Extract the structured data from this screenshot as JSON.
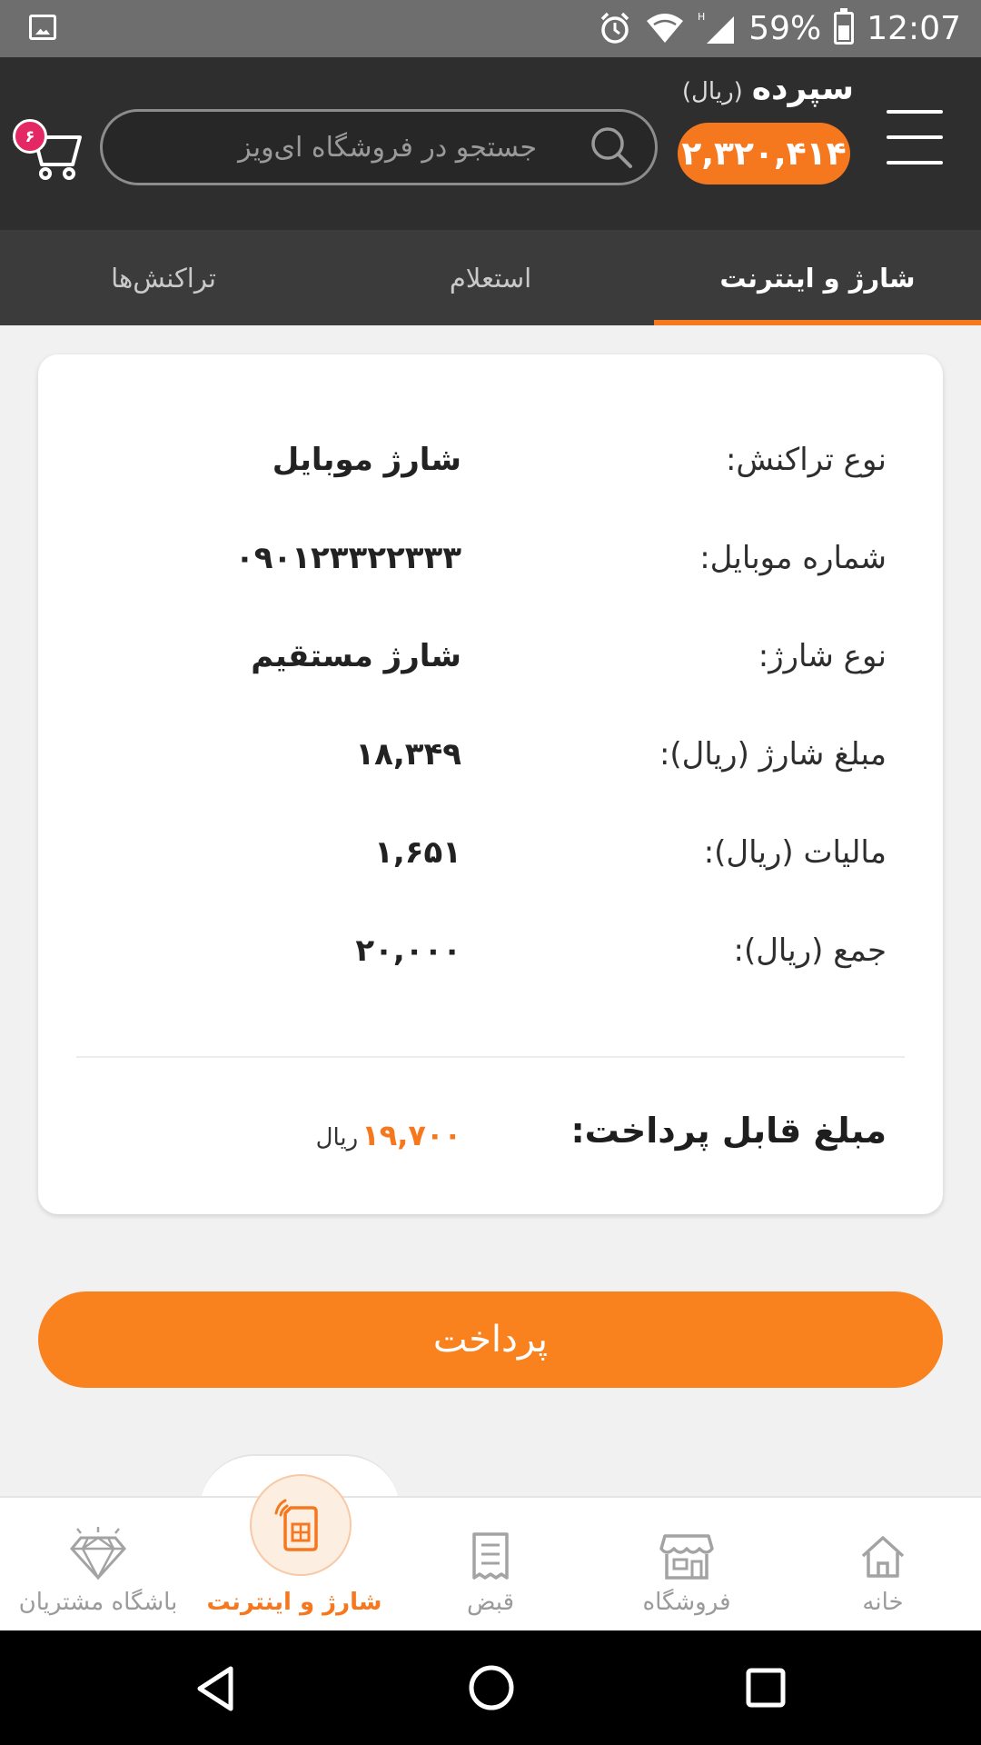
{
  "status_bar": {
    "battery": "59%",
    "time": "12:07",
    "network": "H"
  },
  "header": {
    "balance_title": "سپرده",
    "balance_unit": "(ریال)",
    "balance_value": "۲,۳۲۰,۴۱۴",
    "search_placeholder": "جستجو در فروشگاه ای‌ویز",
    "cart_count": "۶"
  },
  "tabs": [
    {
      "label": "شارژ و اینترنت",
      "active": true
    },
    {
      "label": "استعلام",
      "active": false
    },
    {
      "label": "تراکنش‌ها",
      "active": false
    }
  ],
  "summary": {
    "rows": [
      {
        "label": "نوع تراکنش:",
        "value": "شارژ موبایل"
      },
      {
        "label": "شماره موبایل:",
        "value": "۰۹۰۱۲۳۳۲۲۳۳۳"
      },
      {
        "label": "نوع شارژ:",
        "value": "شارژ مستقیم"
      },
      {
        "label": "مبلغ شارژ (ریال):",
        "value": "۱۸,۳۴۹"
      },
      {
        "label": "مالیات (ریال):",
        "value": "۱,۶۵۱"
      },
      {
        "label": "جمع (ریال):",
        "value": "۲۰,۰۰۰"
      }
    ],
    "payable_label": "مبلغ قابل پرداخت:",
    "payable_value": "۱۹,۷۰۰",
    "payable_unit": "ریال"
  },
  "pay_button": "پرداخت",
  "bottom_nav": [
    {
      "label": "خانه",
      "icon": "home-icon"
    },
    {
      "label": "فروشگاه",
      "icon": "store-icon"
    },
    {
      "label": "قبض",
      "icon": "receipt-icon"
    },
    {
      "label": "شارژ و اینترنت",
      "icon": "sim-card-icon",
      "active": true
    },
    {
      "label": "باشگاه مشتریان",
      "icon": "diamond-icon"
    }
  ],
  "colors": {
    "accent": "#f6781e",
    "header": "#2e2e2e",
    "tabs": "#3b3b3b",
    "badge": "#e32863"
  }
}
